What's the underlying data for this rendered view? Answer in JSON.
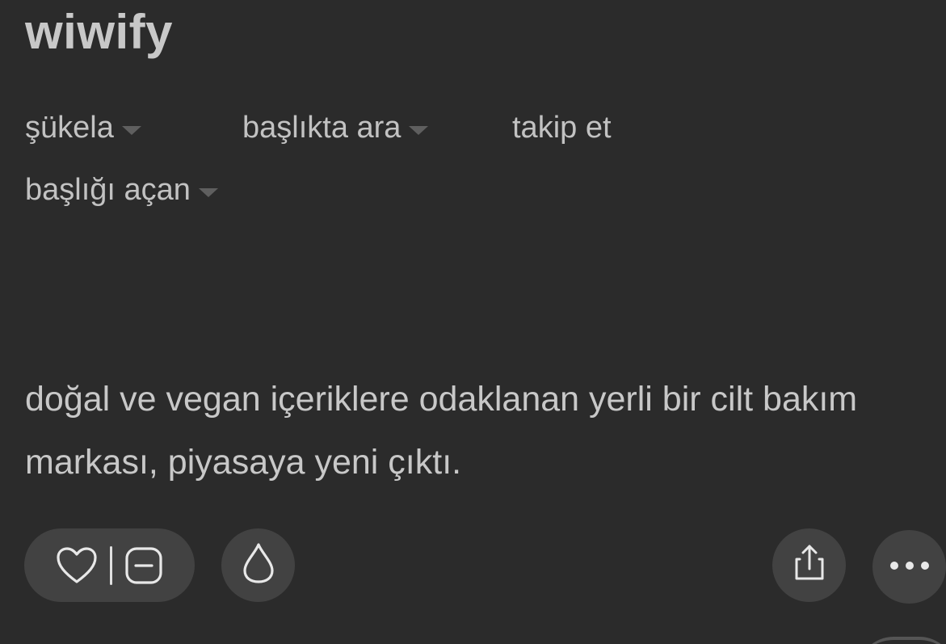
{
  "topic": {
    "title": "wiwify"
  },
  "menu": {
    "sukela": "şükela",
    "search_in_topic": "başlıkta ara",
    "follow": "takip et",
    "topic_author": "başlığı açan"
  },
  "entry": {
    "text": "doğal ve vegan içeriklere odaklanan yerli bir cilt bakım markası, piyasaya yeni çıktı."
  },
  "actions": {
    "icons": [
      "heart-icon",
      "minus-square-icon",
      "drop-icon",
      "share-icon",
      "more-icon"
    ]
  }
}
